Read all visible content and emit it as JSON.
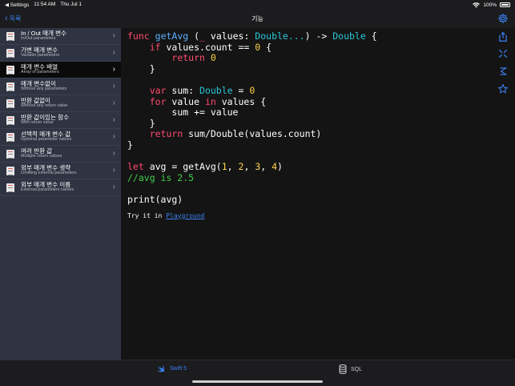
{
  "status": {
    "back_app": "◀ Settings",
    "time": "11:54 AM",
    "date": "Thu Jul 1",
    "battery": "100%"
  },
  "navbar": {
    "back_label": "목록",
    "title": "기능"
  },
  "sidebar": {
    "items": [
      {
        "title": "In / Out 매개 변수",
        "subtitle": "In/Out parameters"
      },
      {
        "title": "가변 매개 변수",
        "subtitle": "Variable parameters"
      },
      {
        "title": "매개 변수 배열",
        "subtitle": "Array of parameters"
      },
      {
        "title": "매개 변수없이",
        "subtitle": "Without any parameters"
      },
      {
        "title": "반환 값없이",
        "subtitle": "Without any return value"
      },
      {
        "title": "반환 값이있는 함수",
        "subtitle": "With return value"
      },
      {
        "title": "선택적 매개 변수 값",
        "subtitle": "Optional parameter values"
      },
      {
        "title": "여러 반환 값",
        "subtitle": "Multiple return values"
      },
      {
        "title": "외부 매개 변수 생략",
        "subtitle": "Omitting external parameters"
      },
      {
        "title": "외부 매개 변수 이름",
        "subtitle": "External parameters names"
      }
    ]
  },
  "code": {
    "tokens": {
      "func": "func",
      "getAvg": "getAvg",
      "sig_open": " (",
      "underscore": "_",
      "values_label": " values: ",
      "double_variadic": "Double...",
      "arrow": ") -> ",
      "double": "Double",
      "brace_open": " {",
      "if": "if",
      "cond": " values.count == ",
      "zero": "0",
      "return": "return",
      "brace_close": "}",
      "var": "var",
      "sum_decl": " sum: ",
      "eq": " = ",
      "for": "for",
      "value": " value ",
      "in": "in",
      "values": " values {",
      "sum_add": "sum += value",
      "return_expr": " sum/Double(values.count)",
      "let": "let",
      "avg_call": " avg = getAvg(",
      "one": "1",
      "two": "2",
      "three": "3",
      "four": "4",
      "comma": ", ",
      "close_paren": ")",
      "comment": "//avg is 2.5",
      "print": "print(avg)"
    },
    "try_text": "Try it in",
    "playground_link": "Playground"
  },
  "tabbar": {
    "swift_label": "Swift 5",
    "sql_label": "SQL"
  },
  "colors": {
    "accent": "#3b82f6",
    "keyword": "#ff4a6d",
    "function": "#5ab0ff",
    "type": "#29c6d8",
    "number": "#ffd24a",
    "comment": "#3fce4b"
  },
  "icons": [
    "gear-icon",
    "share-icon",
    "collapse-icon",
    "expand-icon",
    "star-icon",
    "swift-icon",
    "database-icon",
    "chevron-left-icon",
    "chevron-right-icon",
    "wifi-icon",
    "battery-icon"
  ]
}
